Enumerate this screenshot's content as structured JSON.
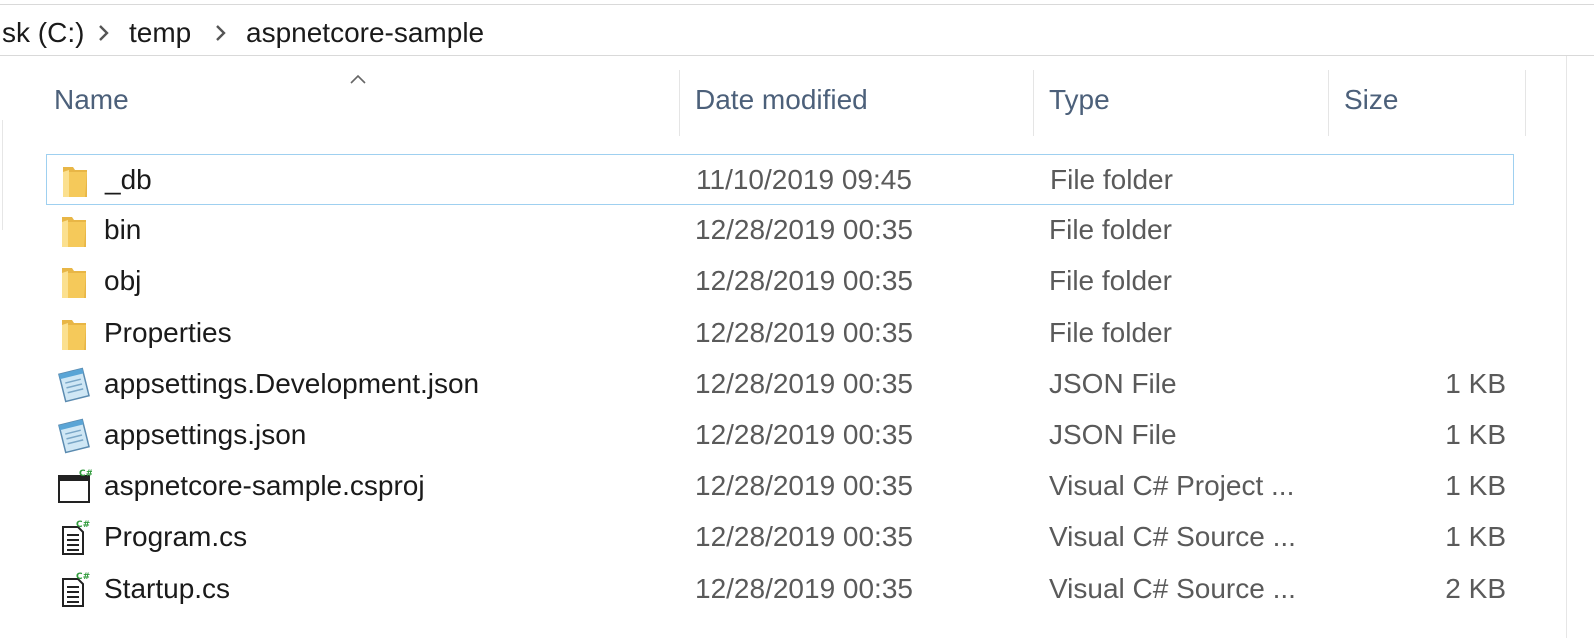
{
  "breadcrumb": {
    "items": [
      "sk (C:)",
      "temp",
      "aspnetcore-sample"
    ]
  },
  "columns": {
    "name": "Name",
    "date": "Date modified",
    "type": "Type",
    "size": "Size"
  },
  "files": [
    {
      "name": "_db",
      "date": "11/10/2019 09:45",
      "type": "File folder",
      "size": "",
      "icon": "folder-icon",
      "selected": true
    },
    {
      "name": "bin",
      "date": "12/28/2019 00:35",
      "type": "File folder",
      "size": "",
      "icon": "folder-icon"
    },
    {
      "name": "obj",
      "date": "12/28/2019 00:35",
      "type": "File folder",
      "size": "",
      "icon": "folder-icon"
    },
    {
      "name": "Properties",
      "date": "12/28/2019 00:35",
      "type": "File folder",
      "size": "",
      "icon": "folder-icon"
    },
    {
      "name": "appsettings.Development.json",
      "date": "12/28/2019 00:35",
      "type": "JSON File",
      "size": "1 KB",
      "icon": "notepad-icon"
    },
    {
      "name": "appsettings.json",
      "date": "12/28/2019 00:35",
      "type": "JSON File",
      "size": "1 KB",
      "icon": "notepad-icon"
    },
    {
      "name": "aspnetcore-sample.csproj",
      "date": "12/28/2019 00:35",
      "type": "Visual C# Project ...",
      "size": "1 KB",
      "icon": "csproj-icon"
    },
    {
      "name": "Program.cs",
      "date": "12/28/2019 00:35",
      "type": "Visual C# Source ...",
      "size": "1 KB",
      "icon": "cs-file-icon"
    },
    {
      "name": "Startup.cs",
      "date": "12/28/2019 00:35",
      "type": "Visual C# Source ...",
      "size": "2 KB",
      "icon": "cs-file-icon"
    }
  ],
  "colors": {
    "selection_border": "#9fd0f0",
    "header_text": "#4c607a",
    "folder_yellow": "#f5c95a"
  }
}
